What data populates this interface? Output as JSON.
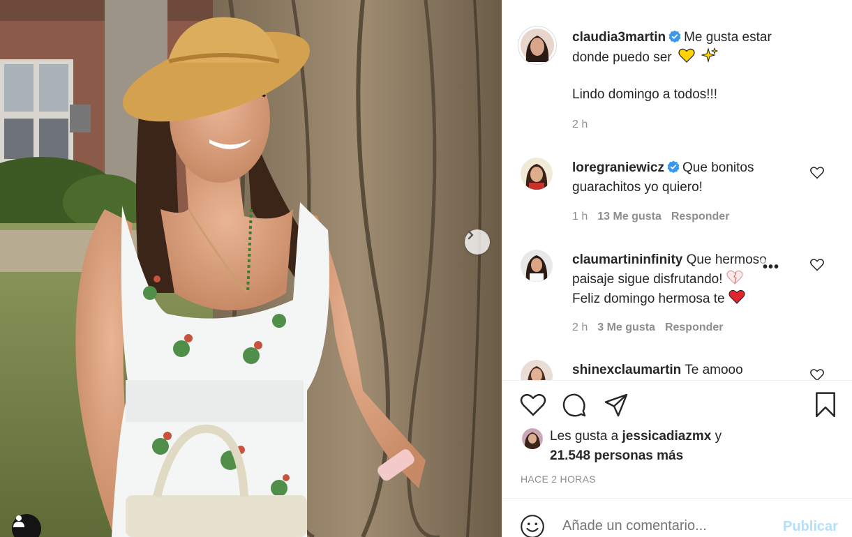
{
  "post": {
    "author": "claudia3martin",
    "caption_line1": "Me gusta estar",
    "caption_line2": "donde puedo ser",
    "caption_line3": "Lindo domingo a todos!!!",
    "time": "2 h",
    "caption_emojis": [
      "yellow-heart",
      "sparkles"
    ]
  },
  "comments": [
    {
      "user": "loregraniewicz",
      "verified": true,
      "text_line1": "Que bonitos",
      "text_line2": "guarachitos yo quiero!",
      "time": "1 h",
      "likes": "13 Me gusta",
      "reply": "Responder"
    },
    {
      "user": "claumartininfinity",
      "verified": false,
      "text_line1": "Que hermoso",
      "text_line2": "paisaje sigue disfrutando!",
      "text_line3": "Feliz domingo hermosa te",
      "time": "2 h",
      "likes": "3 Me gusta",
      "reply": "Responder"
    },
    {
      "user": "shinexclaumartin",
      "verified": false,
      "text_line1": "Te amooo"
    }
  ],
  "more_options": "•••",
  "likes": {
    "prefix": "Les gusta a",
    "user": "jessicadiazmx",
    "conj": "y",
    "others": "21.548 personas más"
  },
  "timestamp": "HACE 2 HORAS",
  "comment_box": {
    "placeholder": "Añade un comentario...",
    "publish": "Publicar"
  },
  "colors": {
    "verified": "#3897f0",
    "publish_disabled": "#b2dffc",
    "secondary_text": "#8e8e8e"
  }
}
